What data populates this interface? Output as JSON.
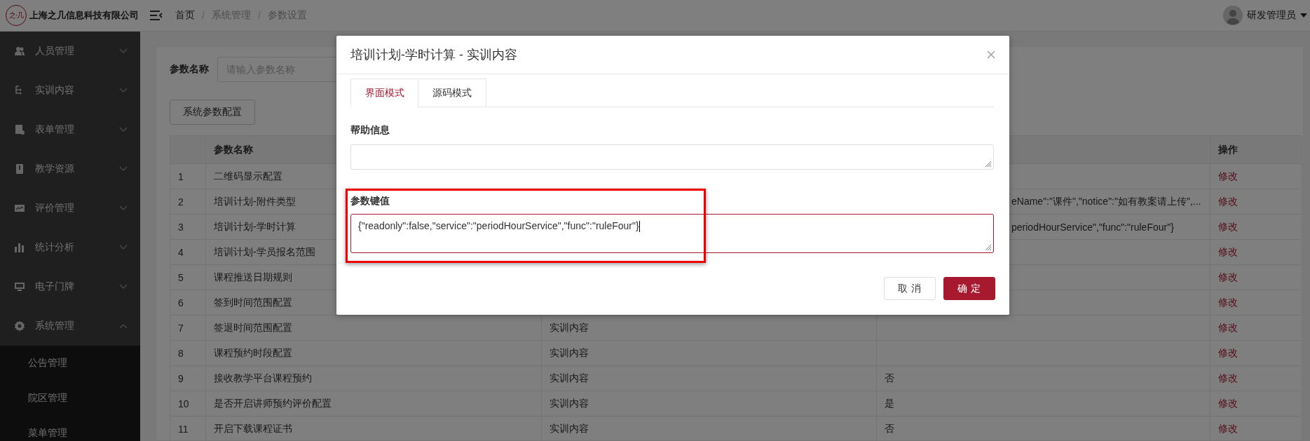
{
  "header": {
    "logo": "之·几",
    "company": "上海之几信息科技有限公司",
    "breadcrumb": [
      {
        "label": "首页"
      },
      {
        "separator": "/",
        "label": "系统管理"
      },
      {
        "separator": "/",
        "label": "参数设置"
      }
    ],
    "user": "研发管理员"
  },
  "sidebar": {
    "items": [
      {
        "label": "人员管理",
        "expanded": false
      },
      {
        "label": "实训内容",
        "expanded": false
      },
      {
        "label": "表单管理",
        "expanded": false
      },
      {
        "label": "教学资源",
        "expanded": false
      },
      {
        "label": "评价管理",
        "expanded": false
      },
      {
        "label": "统计分析",
        "expanded": false
      },
      {
        "label": "电子门牌",
        "expanded": false
      },
      {
        "label": "系统管理",
        "expanded": true,
        "children": [
          {
            "label": "公告管理"
          },
          {
            "label": "院区管理"
          },
          {
            "label": "菜单管理"
          }
        ]
      }
    ]
  },
  "search": {
    "label": "参数名称",
    "placeholder": "请输入参数名称"
  },
  "config_button": "系统参数配置",
  "table": {
    "header": {
      "name": "参数名称",
      "action": "操作"
    },
    "rows": [
      {
        "index": "1",
        "name": "二维码显示配置",
        "action": "修改"
      },
      {
        "index": "2",
        "name": "培训计划-附件类型",
        "column_4": "eName\":\"课件\",\"notice\":\"如有教案请上传\",...",
        "action": "修改"
      },
      {
        "index": "3",
        "name": "培训计划-学时计算",
        "column_4": "periodHourService\",\"func\":\"ruleFour\"}",
        "action": "修改"
      },
      {
        "index": "4",
        "name": "培训计划-学员报名范围",
        "action": "修改"
      },
      {
        "index": "5",
        "name": "课程推送日期规则",
        "action": "修改"
      },
      {
        "index": "6",
        "name": "签到时间范围配置",
        "action": "修改"
      },
      {
        "index": "7",
        "name": "签退时间范围配置",
        "column_3": "实训内容",
        "action": "修改"
      },
      {
        "index": "8",
        "name": "课程预约时段配置",
        "column_3": "实训内容",
        "action": "修改"
      },
      {
        "index": "9",
        "name": "接收教学平台课程预约",
        "column_3": "实训内容",
        "column_4": "否",
        "action": "修改"
      },
      {
        "index": "10",
        "name": "是否开启讲师预约评价配置",
        "column_3": "实训内容",
        "column_4": "是",
        "action": "修改"
      },
      {
        "index": "11",
        "name": "开启下载课程证书",
        "column_3": "实训内容",
        "column_4": "否",
        "action": "修改"
      }
    ]
  },
  "dialog": {
    "title": "培训计划-学时计算 - 实训内容",
    "tabs": [
      {
        "label": "界面模式",
        "selected": true
      },
      {
        "label": "源码模式",
        "selected": false
      }
    ],
    "fields": [
      {
        "label": "帮助信息",
        "focused": false,
        "highlighted": false
      },
      {
        "label": "参数键值",
        "value": "{\"readonly\":false,\"service\":\"periodHourService\",\"func\":\"ruleFour\"}",
        "focused": true,
        "highlighted": true
      }
    ],
    "buttons": [
      {
        "label": "取消",
        "kind": "secondary"
      },
      {
        "label": "确定",
        "kind": "primary"
      }
    ]
  }
}
